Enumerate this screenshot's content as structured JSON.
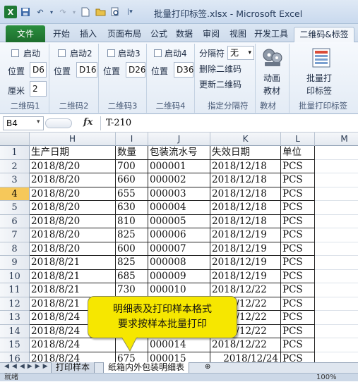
{
  "window": {
    "title": "批量打印标签.xlsx - Microsoft Excel"
  },
  "ribbon_tabs": [
    "文件",
    "开始",
    "插入",
    "页面布局",
    "公式",
    "数据",
    "审阅",
    "视图",
    "开发工具",
    "二维码&标签"
  ],
  "groups": {
    "g1": {
      "label": "二维码1",
      "enable": "启动",
      "pos_label": "位置",
      "pos_value": "D6",
      "cm_label": "厘米",
      "cm_value": "2"
    },
    "g2": {
      "label": "二维码2",
      "enable": "启动2",
      "pos_label": "位置",
      "pos_value": "D16"
    },
    "g3": {
      "label": "二维码3",
      "enable": "启动3",
      "pos_label": "位置",
      "pos_value": "D26"
    },
    "g4": {
      "label": "二维码4",
      "enable": "启动4",
      "pos_label": "位置",
      "pos_value": "D36"
    },
    "sep": {
      "label": "指定分隔符",
      "sep_label": "分隔符",
      "sep_value": "无",
      "delete": "删除二维码",
      "update": "更新二维码"
    },
    "mat": {
      "label": "教材",
      "btn_line1": "动画",
      "btn_line2": "教材"
    },
    "batch": {
      "label": "批量打印标签",
      "btn_line1": "批量打",
      "btn_line2": "印标签"
    }
  },
  "formula": {
    "namebox": "B4",
    "fx": "fx",
    "content": "T-210"
  },
  "columns": [
    "H",
    "I",
    "J",
    "K",
    "L",
    "M"
  ],
  "rows": [
    {
      "num": "1",
      "cells": [
        "生产日期",
        "数量",
        "包装流水号",
        "失效日期",
        "单位"
      ]
    },
    {
      "num": "2",
      "cells": [
        "2018/8/20",
        "700",
        "000001",
        "2018/12/18",
        "PCS"
      ]
    },
    {
      "num": "3",
      "cells": [
        "2018/8/20",
        "660",
        "000002",
        "2018/12/18",
        "PCS"
      ]
    },
    {
      "num": "4",
      "cells": [
        "2018/8/20",
        "655",
        "000003",
        "2018/12/18",
        "PCS"
      ]
    },
    {
      "num": "5",
      "cells": [
        "2018/8/20",
        "630",
        "000004",
        "2018/12/18",
        "PCS"
      ]
    },
    {
      "num": "6",
      "cells": [
        "2018/8/20",
        "810",
        "000005",
        "2018/12/18",
        "PCS"
      ]
    },
    {
      "num": "7",
      "cells": [
        "2018/8/20",
        "825",
        "000006",
        "2018/12/19",
        "PCS"
      ]
    },
    {
      "num": "8",
      "cells": [
        "2018/8/20",
        "600",
        "000007",
        "2018/12/19",
        "PCS"
      ]
    },
    {
      "num": "9",
      "cells": [
        "2018/8/21",
        "825",
        "000008",
        "2018/12/19",
        "PCS"
      ]
    },
    {
      "num": "10",
      "cells": [
        "2018/8/21",
        "685",
        "000009",
        "2018/12/19",
        "PCS"
      ]
    },
    {
      "num": "11",
      "cells": [
        "2018/8/21",
        "730",
        "000010",
        "2018/12/22",
        "PCS"
      ]
    },
    {
      "num": "12",
      "cells": [
        "2018/8/21",
        "",
        "",
        "2018/12/22",
        "PCS"
      ]
    },
    {
      "num": "13",
      "cells": [
        "2018/8/24",
        "",
        "",
        "2018/12/22",
        "PCS"
      ]
    },
    {
      "num": "14",
      "cells": [
        "2018/8/24",
        "",
        "",
        "2018/12/22",
        "PCS"
      ]
    },
    {
      "num": "15",
      "cells": [
        "2018/8/24",
        "",
        "000014",
        "2018/12/22",
        "PCS"
      ]
    },
    {
      "num": "16",
      "cells": [
        "2018/8/24",
        "675",
        "000015",
        "2018/12/24",
        "PCS"
      ]
    }
  ],
  "callout": {
    "line1": "明细表及打印样本格式",
    "line2": "要求按样本批量打印"
  },
  "sheet_tabs": [
    "打印样本",
    "纸箱内外包装明细表"
  ],
  "status": {
    "left": "就绪",
    "zoom": "100%"
  }
}
